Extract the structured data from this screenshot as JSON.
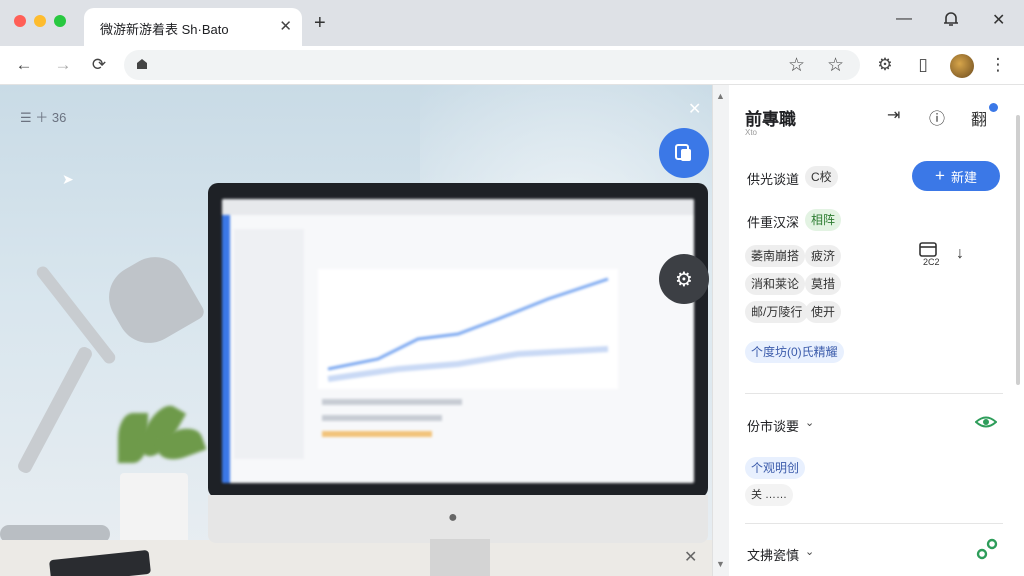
{
  "tab": {
    "title": "微游新游着表 Sh·Bato",
    "close": "✕"
  },
  "window": {
    "new_tab": "+",
    "minimize": "—",
    "bell": "🔔",
    "close": "✕"
  },
  "toolbar": {
    "back": "←",
    "forward": "→",
    "reload": "⟳",
    "lock": "🔒",
    "star": "☆",
    "bookmark_star": "☆",
    "settings": "⚙",
    "device": "▯",
    "menu": "⋮"
  },
  "content": {
    "top_left_text": "☰   ＋ 36",
    "close_x": "✕",
    "bottom_close_x": "✕"
  },
  "panel": {
    "title": "前專職",
    "subtitle": "Xto",
    "share_icon": "⇥",
    "info_icon": "ⓘ",
    "header_label": "翻",
    "row1": {
      "label": "供光谈道",
      "chip": "C校"
    },
    "new_button": {
      "icon": "+",
      "label": "新建"
    },
    "row2": {
      "label": "件重汉深",
      "chip": "相阵"
    },
    "chips_grid": [
      [
        "萎南崩搭",
        "疲济"
      ],
      [
        "消和莱论",
        "莫措"
      ],
      [
        "邮/万陵行",
        "使开"
      ]
    ],
    "side_icon_label": "2C2",
    "side_arrow": "↓",
    "blue_chip": "个度坊(0)氏精耀",
    "section1": {
      "label": "份市谈要",
      "chevron": "⌄"
    },
    "green_chip": "个观明创",
    "small_row": "关  ……",
    "section2": {
      "label": "文拂瓷慎",
      "chevron": "⌄"
    }
  },
  "colors": {
    "accent": "#3b78e7",
    "green": "#2e9d5a"
  }
}
